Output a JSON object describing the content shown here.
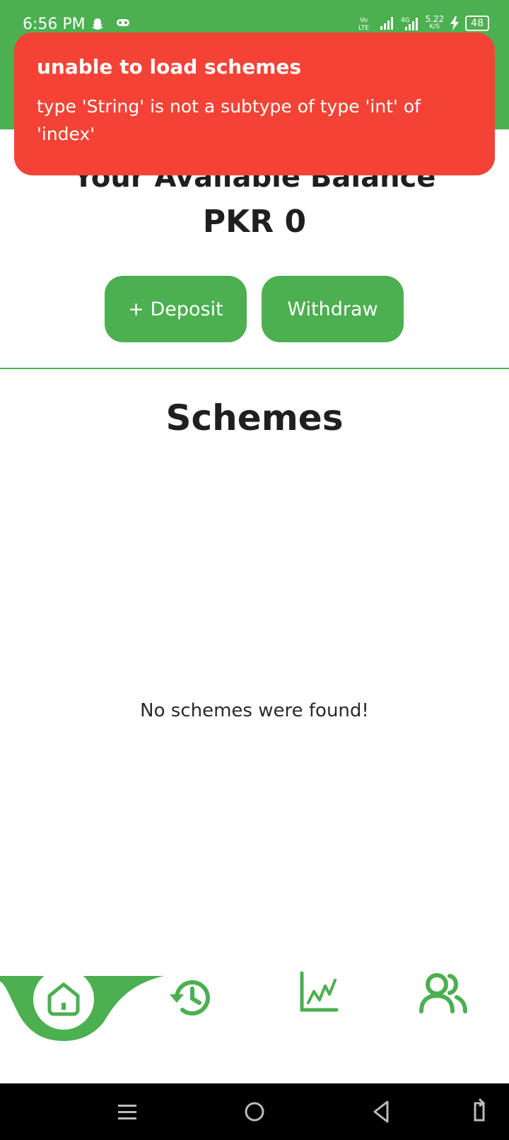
{
  "status": {
    "time": "6:56 PM",
    "network_speed": "5.22",
    "speed_unit": "K/S",
    "battery": "48"
  },
  "toast": {
    "title": "unable to load schemes",
    "message": "type 'String' is not a subtype of type 'int' of 'index'"
  },
  "balance": {
    "title": "Your Available Balance",
    "value": "PKR 0"
  },
  "actions": {
    "deposit_label": "+ Deposit",
    "withdraw_label": "Withdraw"
  },
  "schemes": {
    "title": "Schemes",
    "empty_message": "No schemes were found!"
  },
  "colors": {
    "primary": "#4caf50",
    "error": "#f44336"
  },
  "nav": {
    "items": [
      "home-icon",
      "history-icon",
      "chart-icon",
      "users-icon"
    ],
    "active": "home-icon"
  }
}
